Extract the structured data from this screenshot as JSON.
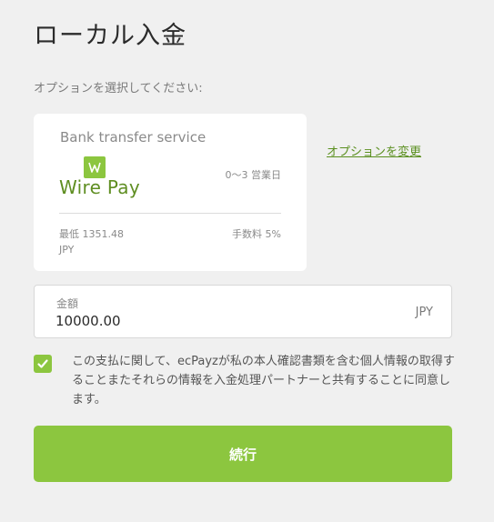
{
  "page": {
    "title": "ローカル入金",
    "prompt": "オプションを選択してください:"
  },
  "option_card": {
    "provider_label": "Bank transfer service",
    "logo_icon": "wirepay-w-badge-icon",
    "logo_text": "Wire Pay",
    "processing_time": "0〜3 営業日",
    "min_amount_line1": "最低 1351.48",
    "min_amount_line2": "JPY",
    "fee": "手数料 5%"
  },
  "change_option_link": "オプションを変更",
  "amount_field": {
    "label": "金額",
    "value": "10000.00",
    "currency": "JPY"
  },
  "consent": {
    "checked": true,
    "text": "この支払に関して、ecPayzが私の本人確認書類を含む個人情報の取得することまたそれらの情報を入金処理パートナーと共有することに同意します。"
  },
  "continue_button": "続行",
  "colors": {
    "accent": "#8cc63f",
    "link": "#5a8f1f",
    "background": "#f0f0f0"
  }
}
